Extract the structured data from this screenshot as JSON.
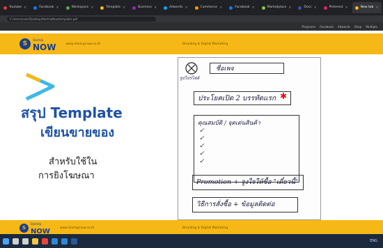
{
  "browser": {
    "tabs": [
      {
        "label": "Youtube",
        "color": "#e53935",
        "active": false
      },
      {
        "label": "Facebook",
        "color": "#1877f2",
        "active": false
      },
      {
        "label": "Workspace",
        "color": "#4caf50",
        "active": false
      },
      {
        "label": "Template",
        "color": "#f6b816",
        "active": false
      },
      {
        "label": "Business",
        "color": "#9c27b0",
        "active": false
      },
      {
        "label": "Adwords",
        "color": "#03a9f4",
        "active": false
      },
      {
        "label": "Commerce",
        "color": "#ff9800",
        "active": false
      },
      {
        "label": "Facebook",
        "color": "#1877f2",
        "active": false
      },
      {
        "label": "Marketplace",
        "color": "#8bc34a",
        "active": false
      },
      {
        "label": "Docs",
        "color": "#3f51b5",
        "active": false
      },
      {
        "label": "Pinterest",
        "color": "#e91e63",
        "active": false
      },
      {
        "label": "New tab",
        "color": "#f6b816",
        "active": true
      }
    ],
    "url": "C:/Users/user/Desktop/StartUpNow/template.pdf",
    "bookmarks": [
      "Programs",
      "Facebook",
      "Adwords",
      "Shop",
      "Multiple"
    ]
  },
  "slide": {
    "logo_small": "StartUp",
    "logo_big": "NOW",
    "site": "www.startupnow.co.th",
    "tagline": "Branding & Digital Marketing",
    "title_line1": "สรุป Template",
    "title_line2": "เขียนขายของ",
    "subtitle_line1": "สำหรับใช้ใน",
    "subtitle_line2": "การยิงโฆษณา"
  },
  "notes": {
    "name_label": "ชื่อเพจ",
    "image_label": "รูปโปรไฟล์",
    "opening_line": "ประโยคเปิด 2 บรรทัดแรก",
    "star": "✱",
    "benefits_label": "คุณสมบัติ / จุดเด่นสินค้า",
    "ticks": [
      "✓",
      "✓",
      "✓",
      "✓",
      "✓"
    ],
    "promotion_line": "Promotion + จูงใจให้ซื้อ \"เดี๋ยวนี้\"",
    "order_line": "วิธีการสั่งซื้อ + ข้อมูลติดต่อ"
  },
  "colors": {
    "brand_yellow": "#f6b816",
    "brand_blue": "#1e52a8",
    "logo_navy": "#1c3f8f",
    "taskbar": "#1b2a3e"
  },
  "taskbar": {
    "icons": [
      "windows-icon",
      "search-icon",
      "task-view-icon",
      "explorer-icon",
      "chrome-icon",
      "store-icon",
      "mail-icon",
      "word-icon"
    ],
    "tray": "ENG"
  }
}
